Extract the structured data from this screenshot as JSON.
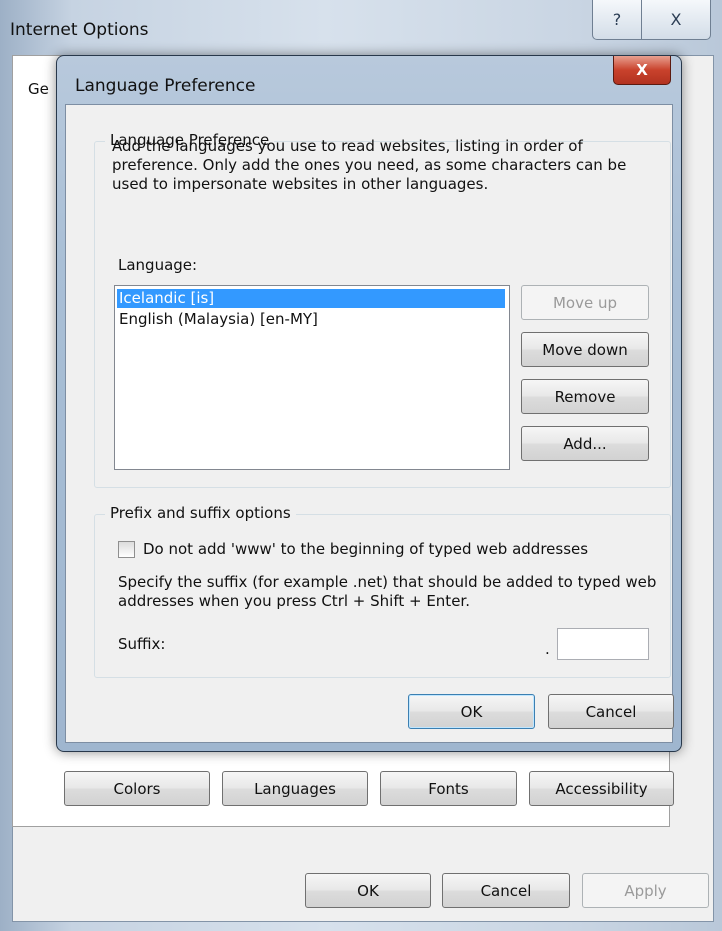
{
  "outer": {
    "title": "Internet Options",
    "help_glyph": "?",
    "close_glyph": "X",
    "tab_fragment": "Ge",
    "buttons": {
      "colors": "Colors",
      "languages": "Languages",
      "fonts": "Fonts",
      "accessibility": "Accessibility"
    },
    "footer": {
      "ok": "OK",
      "cancel": "Cancel",
      "apply": "Apply"
    }
  },
  "dialog": {
    "title": "Language Preference",
    "close_glyph": "X",
    "language_group": {
      "legend": "Language Preference",
      "description": "Add the languages you use to read websites, listing in order of preference. Only add the ones you need, as some characters can be used to impersonate websites in other languages.",
      "list_label": "Language:",
      "languages": [
        {
          "label": "Icelandic [is]",
          "selected": true
        },
        {
          "label": "English (Malaysia) [en-MY]",
          "selected": false
        }
      ],
      "buttons": {
        "move_up": "Move up",
        "move_down": "Move down",
        "remove": "Remove",
        "add": "Add..."
      }
    },
    "prefix_group": {
      "legend": "Prefix and suffix options",
      "checkbox_label": "Do not add 'www' to the beginning of typed web addresses",
      "checkbox_checked": false,
      "suffix_description": "Specify the suffix (for example .net) that should be added to typed web addresses when you press Ctrl + Shift + Enter.",
      "suffix_label": "Suffix:",
      "suffix_dot": ".",
      "suffix_value": ""
    },
    "footer": {
      "ok": "OK",
      "cancel": "Cancel"
    }
  }
}
